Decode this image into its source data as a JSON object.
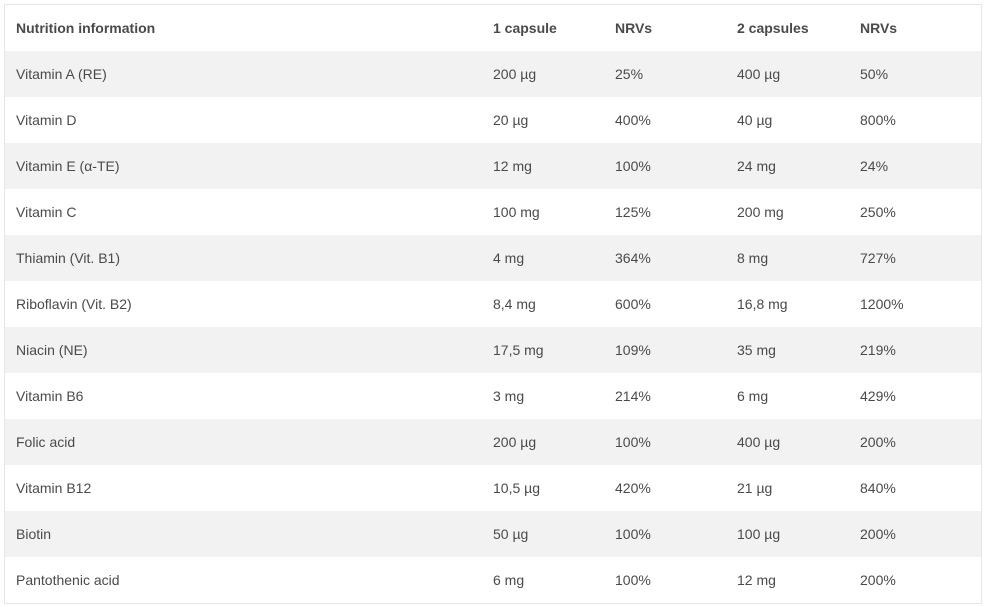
{
  "table": {
    "headers": [
      "Nutrition information",
      "1 capsule",
      "NRVs",
      "2 capsules",
      "NRVs"
    ],
    "rows": [
      [
        "Vitamin A (RE)",
        "200 µg",
        "25%",
        "400 µg",
        "50%"
      ],
      [
        "Vitamin D",
        "20 µg",
        "400%",
        "40 µg",
        "800%"
      ],
      [
        "Vitamin E (α-TE)",
        "12 mg",
        "100%",
        "24 mg",
        "24%"
      ],
      [
        "Vitamin C",
        "100 mg",
        "125%",
        "200 mg",
        "250%"
      ],
      [
        "Thiamin (Vit. B1)",
        "4 mg",
        "364%",
        "8 mg",
        "727%"
      ],
      [
        "Riboflavin (Vit. B2)",
        "8,4 mg",
        "600%",
        "16,8 mg",
        "1200%"
      ],
      [
        "Niacin (NE)",
        "17,5 mg",
        "109%",
        "35 mg",
        "219%"
      ],
      [
        "Vitamin B6",
        "3 mg",
        "214%",
        "6 mg",
        "429%"
      ],
      [
        "Folic acid",
        "200 µg",
        "100%",
        "400 µg",
        "200%"
      ],
      [
        "Vitamin B12",
        "10,5 µg",
        "420%",
        "21 µg",
        "840%"
      ],
      [
        "Biotin",
        "50 µg",
        "100%",
        "100 µg",
        "200%"
      ],
      [
        "Pantothenic acid",
        "6 mg",
        "100%",
        "12 mg",
        "200%"
      ]
    ]
  }
}
